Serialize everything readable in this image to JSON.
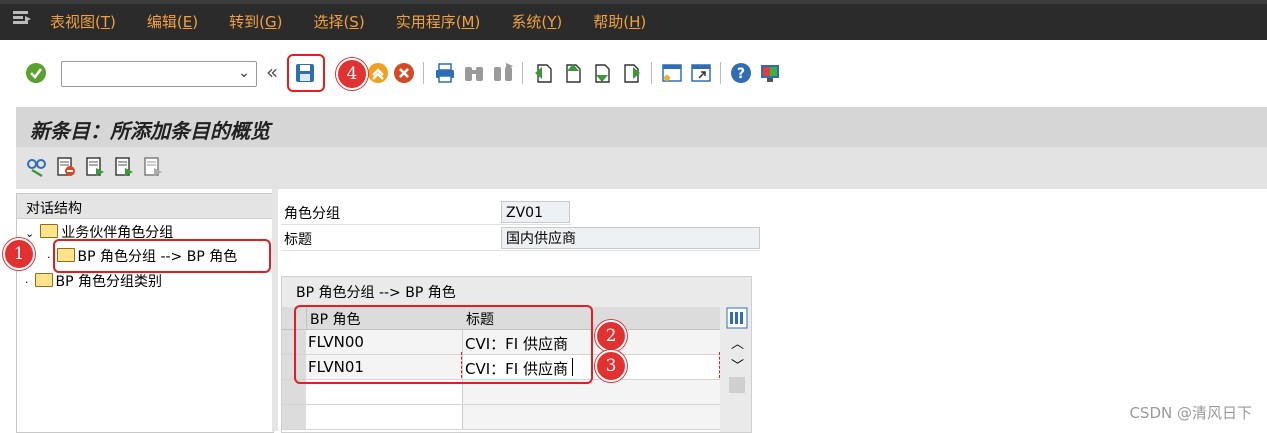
{
  "menu": {
    "items": [
      {
        "label": "表视图(T)",
        "key": "T"
      },
      {
        "label": "编辑(E)",
        "key": "E"
      },
      {
        "label": "转到(G)",
        "key": "G"
      },
      {
        "label": "选择(S)",
        "key": "S"
      },
      {
        "label": "实用程序(M)",
        "key": "M"
      },
      {
        "label": "系统(Y)",
        "key": "Y"
      },
      {
        "label": "帮助(H)",
        "key": "H"
      }
    ]
  },
  "toolbar": {
    "command_value": "",
    "back_symbol": "«",
    "icons": [
      "confirm-icon",
      "save-icon",
      "back-icon",
      "exit-icon",
      "cancel-icon",
      "print-icon",
      "find-icon",
      "find-next-icon",
      "first-page-icon",
      "prev-page-icon",
      "next-page-icon",
      "last-page-icon",
      "new-session-icon",
      "shortcut-icon",
      "help-icon",
      "customize-layout-icon"
    ]
  },
  "title": "新条目：所添加条目的概览",
  "tree": {
    "header": "对话结构",
    "nodes": [
      {
        "label": "业务伙伴角色分组",
        "level": 0,
        "expanded": true
      },
      {
        "label": "BP 角色分组 --> BP 角色",
        "level": 1,
        "selected": true
      },
      {
        "label": "BP 角色分组类别",
        "level": 0
      }
    ]
  },
  "form": {
    "role_group_label": "角色分组",
    "role_group_value": "ZV01",
    "title_label": "标题",
    "title_value": "国内供应商"
  },
  "table": {
    "group_title": "BP 角色分组 --> BP 角色",
    "columns": [
      "BP 角色",
      "标题"
    ],
    "rows": [
      {
        "role": "FLVN00",
        "title": "CVI：FI 供应商"
      },
      {
        "role": "FLVN01",
        "title": "CVI：FI 供应商"
      }
    ]
  },
  "annotations": [
    "1",
    "2",
    "3",
    "4"
  ],
  "watermark": "CSDN @清风日下"
}
